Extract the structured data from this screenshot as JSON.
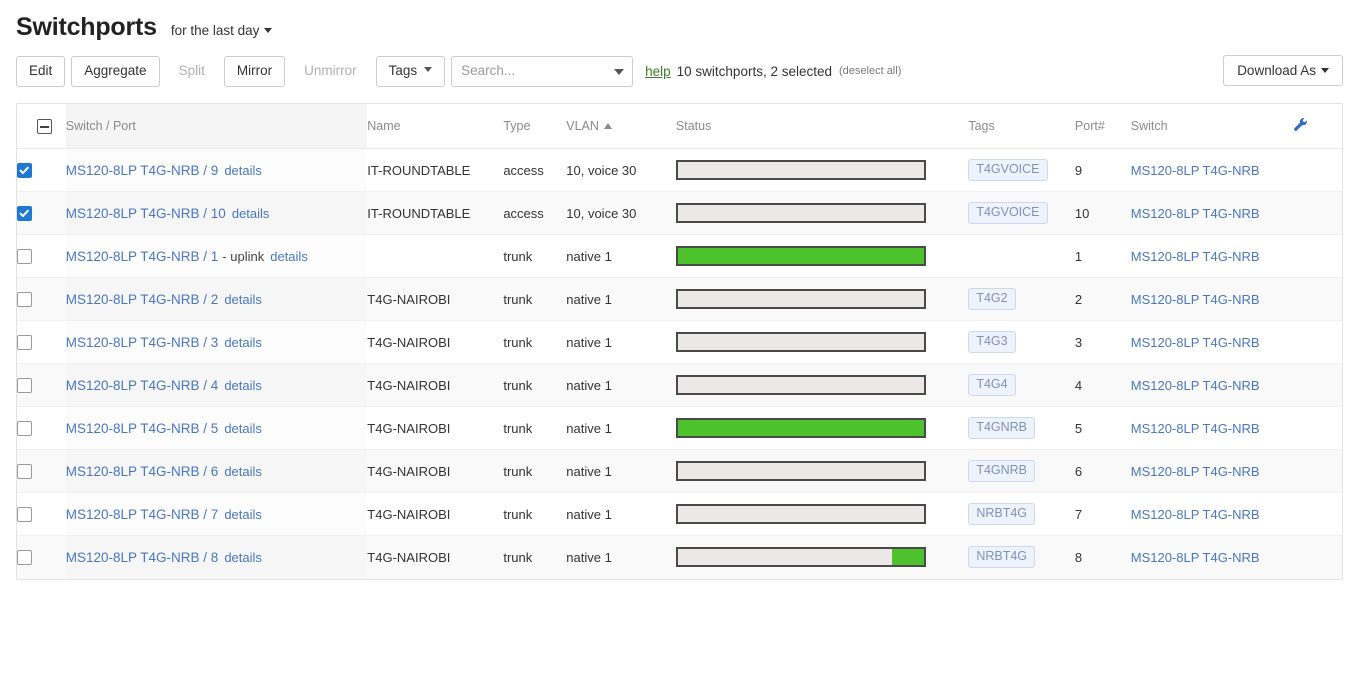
{
  "header": {
    "title": "Switchports",
    "timespan_label": "for the last day"
  },
  "toolbar": {
    "buttons": [
      {
        "label": "Edit",
        "disabled": false
      },
      {
        "label": "Aggregate",
        "disabled": false
      },
      {
        "label": "Split",
        "disabled": true
      },
      {
        "label": "Mirror",
        "disabled": false
      },
      {
        "label": "Unmirror",
        "disabled": true
      }
    ],
    "tags_label": "Tags",
    "search_placeholder": "Search...",
    "search_value": "",
    "help_label": "help",
    "count_text": "10 switchports, 2 selected",
    "deselect_label": "(deselect all)",
    "download_label": "Download As"
  },
  "table": {
    "columns": {
      "check": "",
      "port": "Switch / Port",
      "name": "Name",
      "type": "Type",
      "vlan": "VLAN",
      "status": "Status",
      "tags": "Tags",
      "portnum": "Port#",
      "switch": "Switch"
    },
    "sorted_column": "vlan",
    "sort_direction": "asc",
    "details_label": "details",
    "rows": [
      {
        "selected": true,
        "port": "MS120-8LP T4G-NRB / 9",
        "note": "",
        "name": "IT-ROUNDTABLE",
        "type": "access",
        "vlan": "10, voice 30",
        "status_pct": 0,
        "tag": "T4GVOICE",
        "portnum": "9",
        "switch": "MS120-8LP T4G-NRB"
      },
      {
        "selected": true,
        "port": "MS120-8LP T4G-NRB / 10",
        "note": "",
        "name": "IT-ROUNDTABLE",
        "type": "access",
        "vlan": "10, voice 30",
        "status_pct": 0,
        "tag": "T4GVOICE",
        "portnum": "10",
        "switch": "MS120-8LP T4G-NRB"
      },
      {
        "selected": false,
        "port": "MS120-8LP T4G-NRB / 1",
        "note": "- uplink",
        "name": "",
        "type": "trunk",
        "vlan": "native 1",
        "status_pct": 100,
        "tag": "",
        "portnum": "1",
        "switch": "MS120-8LP T4G-NRB"
      },
      {
        "selected": false,
        "port": "MS120-8LP T4G-NRB / 2",
        "note": "",
        "name": "T4G-NAIROBI",
        "type": "trunk",
        "vlan": "native 1",
        "status_pct": 0,
        "tag": "T4G2",
        "portnum": "2",
        "switch": "MS120-8LP T4G-NRB"
      },
      {
        "selected": false,
        "port": "MS120-8LP T4G-NRB / 3",
        "note": "",
        "name": "T4G-NAIROBI",
        "type": "trunk",
        "vlan": "native 1",
        "status_pct": 0,
        "tag": "T4G3",
        "portnum": "3",
        "switch": "MS120-8LP T4G-NRB"
      },
      {
        "selected": false,
        "port": "MS120-8LP T4G-NRB / 4",
        "note": "",
        "name": "T4G-NAIROBI",
        "type": "trunk",
        "vlan": "native 1",
        "status_pct": 0,
        "tag": "T4G4",
        "portnum": "4",
        "switch": "MS120-8LP T4G-NRB"
      },
      {
        "selected": false,
        "port": "MS120-8LP T4G-NRB / 5",
        "note": "",
        "name": "T4G-NAIROBI",
        "type": "trunk",
        "vlan": "native 1",
        "status_pct": 100,
        "tag": "T4GNRB",
        "portnum": "5",
        "switch": "MS120-8LP T4G-NRB"
      },
      {
        "selected": false,
        "port": "MS120-8LP T4G-NRB / 6",
        "note": "",
        "name": "T4G-NAIROBI",
        "type": "trunk",
        "vlan": "native 1",
        "status_pct": 0,
        "tag": "T4GNRB",
        "portnum": "6",
        "switch": "MS120-8LP T4G-NRB"
      },
      {
        "selected": false,
        "port": "MS120-8LP T4G-NRB / 7",
        "note": "",
        "name": "T4G-NAIROBI",
        "type": "trunk",
        "vlan": "native 1",
        "status_pct": 0,
        "tag": "NRBT4G",
        "portnum": "7",
        "switch": "MS120-8LP T4G-NRB"
      },
      {
        "selected": false,
        "port": "MS120-8LP T4G-NRB / 8",
        "note": "",
        "name": "T4G-NAIROBI",
        "type": "trunk",
        "vlan": "native 1",
        "status_pct": 13,
        "tag": "NRBT4G",
        "portnum": "8",
        "switch": "MS120-8LP T4G-NRB"
      }
    ]
  },
  "colors": {
    "link": "#4a76c4",
    "status_green": "#4dc22d",
    "status_empty": "#ece8e8",
    "checkbox_blue": "#1f78d1",
    "help_green": "#3a7d23",
    "tag_text": "#7f92bd",
    "tag_bg": "#eef2fb"
  }
}
